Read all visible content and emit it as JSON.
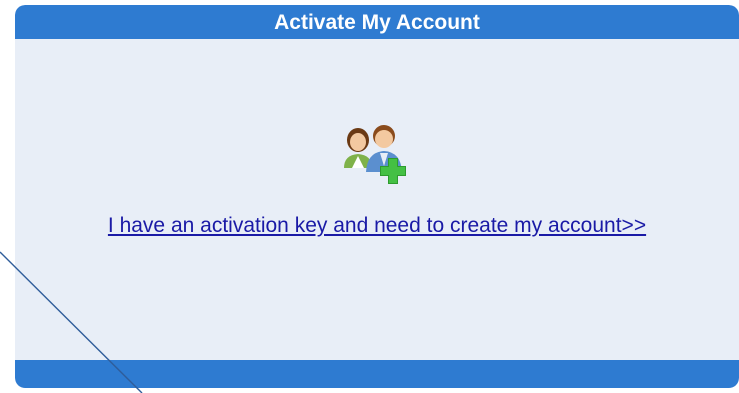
{
  "panel": {
    "title": "Activate My Account",
    "link_text": "I have an activation key and need to create my account>>",
    "icon": "users-add-icon"
  },
  "colors": {
    "header_bg": "#2e7bd1",
    "panel_bg": "#e8eef7",
    "link": "#1a1aa6",
    "annotation_line": "#2f5d9a"
  }
}
